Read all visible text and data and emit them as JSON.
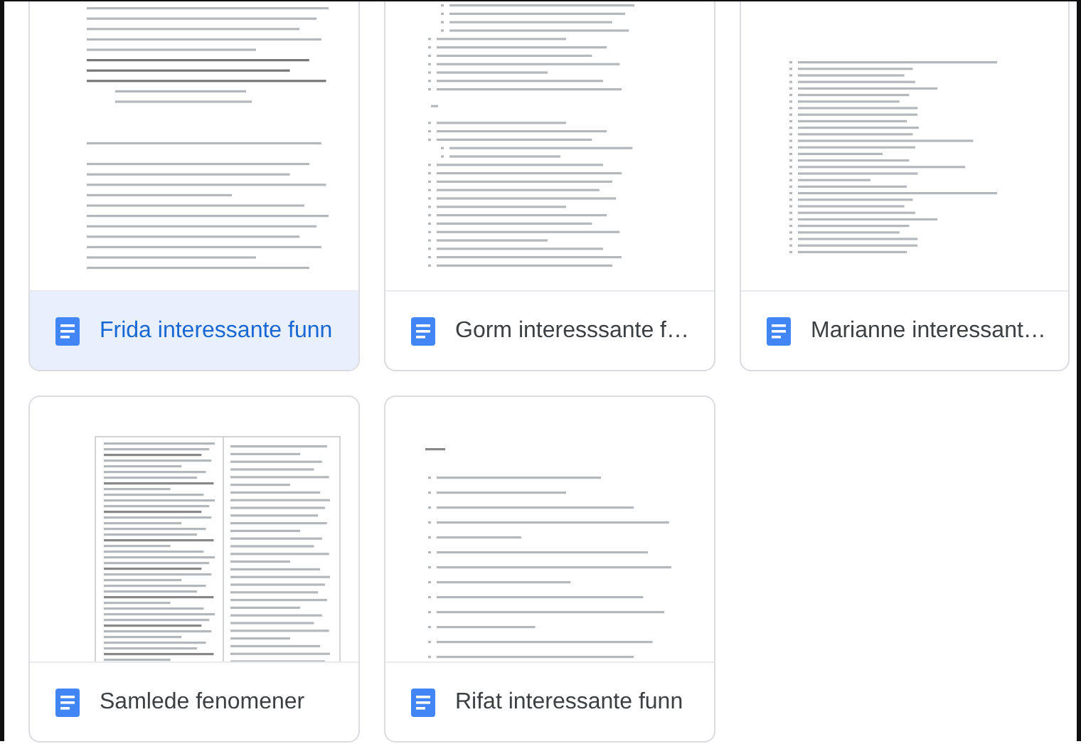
{
  "files": [
    {
      "title": "Frida interessante funn",
      "selected": true
    },
    {
      "title": "Gorm interesssante f…",
      "selected": false
    },
    {
      "title": "Marianne interessant…",
      "selected": false
    },
    {
      "title": "Samlede fenomener",
      "selected": false
    },
    {
      "title": "Rifat interessante funn",
      "selected": false
    }
  ]
}
